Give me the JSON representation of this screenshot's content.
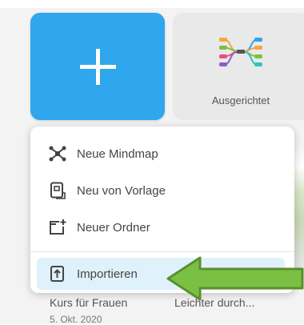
{
  "tiles": {
    "new_label": "",
    "template_label": "Ausgerichtet"
  },
  "menu": {
    "items": [
      {
        "label": "Neue Mindmap",
        "icon": "mindmap-icon"
      },
      {
        "label": "Neu von Vorlage",
        "icon": "template-icon"
      },
      {
        "label": "Neuer Ordner",
        "icon": "new-folder-icon"
      },
      {
        "label": "Importieren",
        "icon": "import-icon",
        "highlighted": true
      }
    ]
  },
  "background_cards": [
    {
      "title": "Kurs für Frauen",
      "date": "5. Okt. 2020"
    },
    {
      "title": "Leichter durch..."
    }
  ],
  "annotation": {
    "arrow_color": "#7ac143",
    "icon": "pointer-arrow-icon"
  },
  "colors": {
    "accent": "#2fa6ee",
    "menu_highlight": "#dff1fb"
  }
}
